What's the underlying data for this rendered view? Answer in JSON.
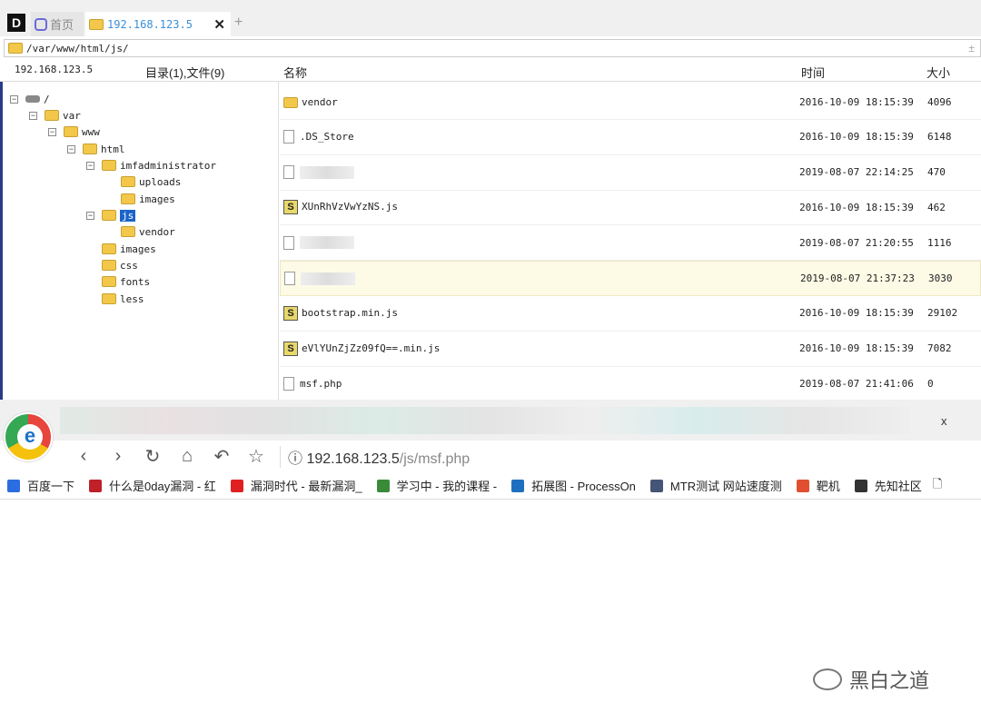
{
  "tabs": {
    "home": "首页",
    "remote": "192.168.123.5",
    "close": "✕",
    "add": "+"
  },
  "path": "/var/www/html/js/",
  "header": {
    "host": "192.168.123.5",
    "summary": "目录(1),文件(9)",
    "name": "名称",
    "time": "时间",
    "size": "大小"
  },
  "tree": [
    {
      "label": "/",
      "level": 0,
      "toggle": "⊟"
    },
    {
      "label": "var",
      "level": 1,
      "toggle": "⊟"
    },
    {
      "label": "www",
      "level": 2,
      "toggle": "⊟"
    },
    {
      "label": "html",
      "level": 3,
      "toggle": "⊟"
    },
    {
      "label": "imfadministrator",
      "level": 4,
      "toggle": "⊟"
    },
    {
      "label": "uploads",
      "level": 5,
      "toggle": ""
    },
    {
      "label": "images",
      "level": 5,
      "toggle": ""
    },
    {
      "label": "js",
      "level": 4,
      "toggle": "⊟",
      "selected": true
    },
    {
      "label": "vendor",
      "level": 5,
      "toggle": ""
    },
    {
      "label": "images",
      "level": 4,
      "toggle": ""
    },
    {
      "label": "css",
      "level": 4,
      "toggle": ""
    },
    {
      "label": "fonts",
      "level": 4,
      "toggle": ""
    },
    {
      "label": "less",
      "level": 4,
      "toggle": ""
    }
  ],
  "files": [
    {
      "name": "vendor",
      "type": "folder",
      "time": "2016-10-09 18:15:39",
      "size": "4096"
    },
    {
      "name": ".DS_Store",
      "type": "file",
      "time": "2016-10-09 18:15:39",
      "size": "6148"
    },
    {
      "name": "",
      "type": "blurred",
      "time": "2019-08-07 22:14:25",
      "size": "470"
    },
    {
      "name": "XUnRhVzVwYzNS.js",
      "type": "js",
      "time": "2016-10-09 18:15:39",
      "size": "462"
    },
    {
      "name": "",
      "type": "blurred",
      "time": "2019-08-07 21:20:55",
      "size": "1116"
    },
    {
      "name": "",
      "type": "blurred",
      "time": "2019-08-07 21:37:23",
      "size": "3030",
      "highlight": true
    },
    {
      "name": "bootstrap.min.js",
      "type": "js",
      "time": "2016-10-09 18:15:39",
      "size": "29102"
    },
    {
      "name": "eVlYUnZjZz09fQ==.min.js",
      "type": "js",
      "time": "2016-10-09 18:15:39",
      "size": "7082"
    },
    {
      "name": "msf.php",
      "type": "file",
      "time": "2019-08-07 21:41:06",
      "size": "0"
    }
  ],
  "browser": {
    "close": "x",
    "url_host": "192.168.123.5",
    "url_path": "/js/msf.php",
    "bookmarks": [
      {
        "label": "百度一下",
        "color": "#2b6de0"
      },
      {
        "label": "什么是0day漏洞 - 红",
        "color": "#c0202a"
      },
      {
        "label": "漏洞时代 - 最新漏洞_",
        "color": "#e02020"
      },
      {
        "label": "学习中 - 我的课程 - ",
        "color": "#3a8a3a"
      },
      {
        "label": "拓展图 - ProcessOn",
        "color": "#1f6fc0"
      },
      {
        "label": "MTR测试 网站速度测",
        "color": "#445577"
      },
      {
        "label": "靶机",
        "color": "#e05030"
      },
      {
        "label": "先知社区",
        "color": "#333333"
      }
    ]
  },
  "watermark": "黑白之道"
}
